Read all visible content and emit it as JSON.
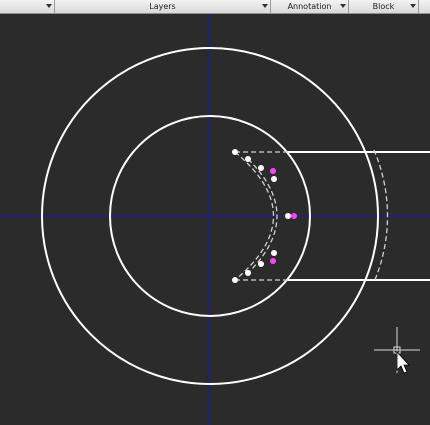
{
  "ribbon": {
    "panels": [
      {
        "label": ""
      },
      {
        "label": "Layers"
      },
      {
        "label": "Annotation"
      },
      {
        "label": "Block"
      },
      {
        "label": ""
      }
    ]
  },
  "colors": {
    "background": "#2b2b2b",
    "ucs_axis": "#1a1aa8",
    "geometry": "#ffffff",
    "hidden_line": "#c8c8c8",
    "grip_selected": "#ff40ff"
  },
  "icons": {
    "cursor": "crosshair-arrow-cursor-icon"
  }
}
